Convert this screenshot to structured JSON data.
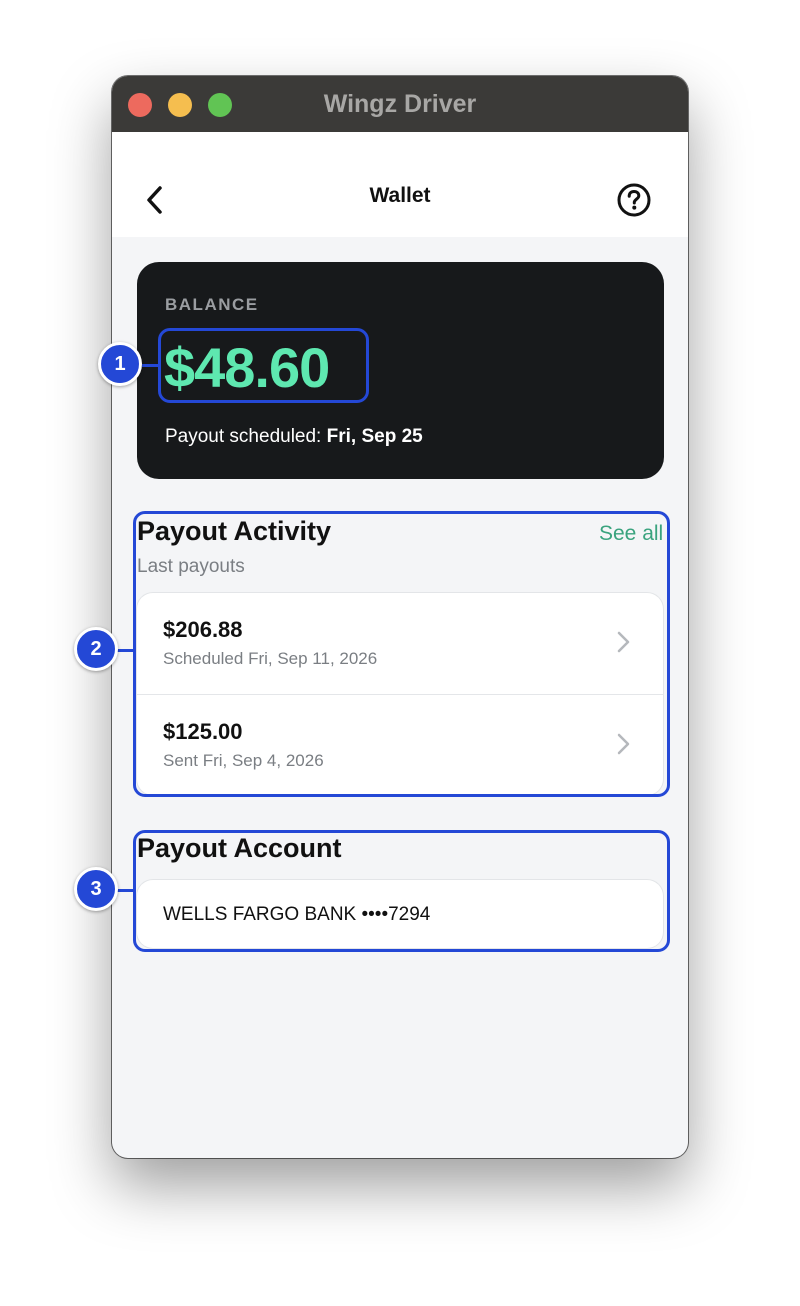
{
  "window": {
    "title": "Wingz Driver"
  },
  "nav": {
    "title": "Wallet",
    "back_icon": "chevron-left-icon",
    "help_icon": "question-circle-icon"
  },
  "balance": {
    "label": "BALANCE",
    "amount": "$48.60",
    "payout_prefix": "Payout scheduled:",
    "payout_date": "Fri, Sep 25"
  },
  "payout_activity": {
    "title": "Payout Activity",
    "see_all": "See all",
    "subtitle": "Last payouts",
    "items": [
      {
        "amount": "$206.88",
        "status": "Scheduled Fri, Sep 11, 2026"
      },
      {
        "amount": "$125.00",
        "status": "Sent Fri, Sep 4, 2026"
      }
    ]
  },
  "payout_account": {
    "title": "Payout Account",
    "account": "WELLS FARGO BANK ••••7294"
  },
  "annotations": [
    "1",
    "2",
    "3"
  ],
  "colors": {
    "accent_green": "#5ee8b0",
    "link_green": "#3aa37e",
    "annotation_blue": "#2448d6",
    "card_dark": "#17191b"
  }
}
